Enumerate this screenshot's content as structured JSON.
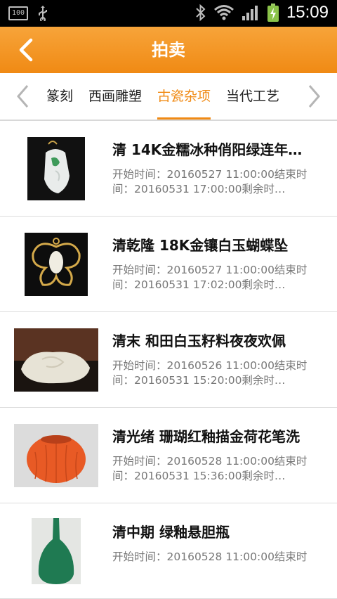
{
  "status_bar": {
    "battery_label": "100",
    "time": "15:09",
    "icons": [
      "battery-icon",
      "usb-icon",
      "bluetooth-icon",
      "wifi-icon",
      "signal-icon",
      "battery-charging-icon"
    ]
  },
  "header": {
    "title": "拍卖",
    "back_icon": "chevron-left-icon"
  },
  "tabs": {
    "items": [
      "法篆刻",
      "西画雕塑",
      "古瓷杂项",
      "当代工艺"
    ],
    "active_index": 2,
    "accent_color": "#f08a14"
  },
  "items": [
    {
      "title": "清 14K金糯冰种俏阳绿连年…",
      "desc_line1": "开始时间：20160527 11:00:00结束时",
      "desc_line2": "间：20160531 17:00:00剩余时…"
    },
    {
      "title": "清乾隆 18K金镶白玉蝴蝶坠",
      "desc_line1": "开始时间：20160527 11:00:00结束时",
      "desc_line2": "间：20160531 17:02:00剩余时…"
    },
    {
      "title": "清末 和田白玉籽料夜夜欢佩",
      "desc_line1": "开始时间：20160526 11:00:00结束时",
      "desc_line2": "间：20160531 15:20:00剩余时…"
    },
    {
      "title": "清光绪 珊瑚红釉描金荷花笔洗",
      "desc_line1": "开始时间：20160528 11:00:00结束时",
      "desc_line2": "间：20160531 15:36:00剩余时…"
    },
    {
      "title": "清中期 绿釉悬胆瓶",
      "desc_line1": "开始时间：20160528 11:00:00结束时",
      "desc_line2": ""
    }
  ]
}
